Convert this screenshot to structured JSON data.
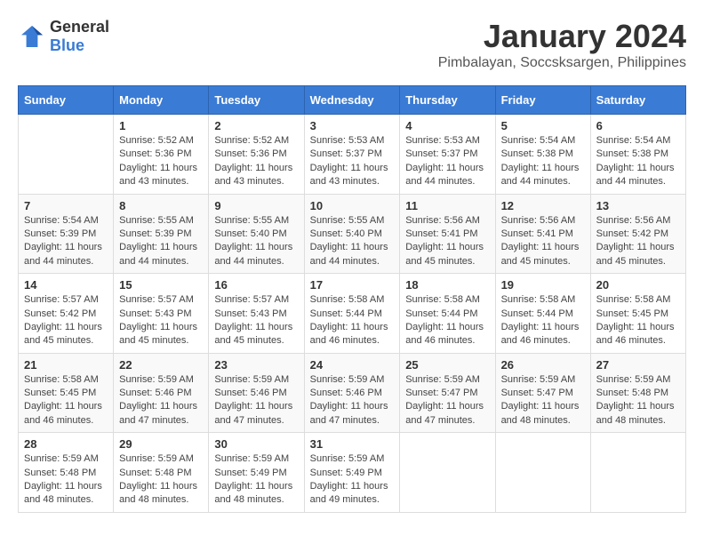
{
  "logo": {
    "general": "General",
    "blue": "Blue"
  },
  "title": "January 2024",
  "location": "Pimbalayan, Soccsksargen, Philippines",
  "days_header": [
    "Sunday",
    "Monday",
    "Tuesday",
    "Wednesday",
    "Thursday",
    "Friday",
    "Saturday"
  ],
  "weeks": [
    [
      {
        "day": "",
        "info": ""
      },
      {
        "day": "1",
        "info": "Sunrise: 5:52 AM\nSunset: 5:36 PM\nDaylight: 11 hours\nand 43 minutes."
      },
      {
        "day": "2",
        "info": "Sunrise: 5:52 AM\nSunset: 5:36 PM\nDaylight: 11 hours\nand 43 minutes."
      },
      {
        "day": "3",
        "info": "Sunrise: 5:53 AM\nSunset: 5:37 PM\nDaylight: 11 hours\nand 43 minutes."
      },
      {
        "day": "4",
        "info": "Sunrise: 5:53 AM\nSunset: 5:37 PM\nDaylight: 11 hours\nand 44 minutes."
      },
      {
        "day": "5",
        "info": "Sunrise: 5:54 AM\nSunset: 5:38 PM\nDaylight: 11 hours\nand 44 minutes."
      },
      {
        "day": "6",
        "info": "Sunrise: 5:54 AM\nSunset: 5:38 PM\nDaylight: 11 hours\nand 44 minutes."
      }
    ],
    [
      {
        "day": "7",
        "info": "Sunrise: 5:54 AM\nSunset: 5:39 PM\nDaylight: 11 hours\nand 44 minutes."
      },
      {
        "day": "8",
        "info": "Sunrise: 5:55 AM\nSunset: 5:39 PM\nDaylight: 11 hours\nand 44 minutes."
      },
      {
        "day": "9",
        "info": "Sunrise: 5:55 AM\nSunset: 5:40 PM\nDaylight: 11 hours\nand 44 minutes."
      },
      {
        "day": "10",
        "info": "Sunrise: 5:55 AM\nSunset: 5:40 PM\nDaylight: 11 hours\nand 44 minutes."
      },
      {
        "day": "11",
        "info": "Sunrise: 5:56 AM\nSunset: 5:41 PM\nDaylight: 11 hours\nand 45 minutes."
      },
      {
        "day": "12",
        "info": "Sunrise: 5:56 AM\nSunset: 5:41 PM\nDaylight: 11 hours\nand 45 minutes."
      },
      {
        "day": "13",
        "info": "Sunrise: 5:56 AM\nSunset: 5:42 PM\nDaylight: 11 hours\nand 45 minutes."
      }
    ],
    [
      {
        "day": "14",
        "info": "Sunrise: 5:57 AM\nSunset: 5:42 PM\nDaylight: 11 hours\nand 45 minutes."
      },
      {
        "day": "15",
        "info": "Sunrise: 5:57 AM\nSunset: 5:43 PM\nDaylight: 11 hours\nand 45 minutes."
      },
      {
        "day": "16",
        "info": "Sunrise: 5:57 AM\nSunset: 5:43 PM\nDaylight: 11 hours\nand 45 minutes."
      },
      {
        "day": "17",
        "info": "Sunrise: 5:58 AM\nSunset: 5:44 PM\nDaylight: 11 hours\nand 46 minutes."
      },
      {
        "day": "18",
        "info": "Sunrise: 5:58 AM\nSunset: 5:44 PM\nDaylight: 11 hours\nand 46 minutes."
      },
      {
        "day": "19",
        "info": "Sunrise: 5:58 AM\nSunset: 5:44 PM\nDaylight: 11 hours\nand 46 minutes."
      },
      {
        "day": "20",
        "info": "Sunrise: 5:58 AM\nSunset: 5:45 PM\nDaylight: 11 hours\nand 46 minutes."
      }
    ],
    [
      {
        "day": "21",
        "info": "Sunrise: 5:58 AM\nSunset: 5:45 PM\nDaylight: 11 hours\nand 46 minutes."
      },
      {
        "day": "22",
        "info": "Sunrise: 5:59 AM\nSunset: 5:46 PM\nDaylight: 11 hours\nand 47 minutes."
      },
      {
        "day": "23",
        "info": "Sunrise: 5:59 AM\nSunset: 5:46 PM\nDaylight: 11 hours\nand 47 minutes."
      },
      {
        "day": "24",
        "info": "Sunrise: 5:59 AM\nSunset: 5:46 PM\nDaylight: 11 hours\nand 47 minutes."
      },
      {
        "day": "25",
        "info": "Sunrise: 5:59 AM\nSunset: 5:47 PM\nDaylight: 11 hours\nand 47 minutes."
      },
      {
        "day": "26",
        "info": "Sunrise: 5:59 AM\nSunset: 5:47 PM\nDaylight: 11 hours\nand 48 minutes."
      },
      {
        "day": "27",
        "info": "Sunrise: 5:59 AM\nSunset: 5:48 PM\nDaylight: 11 hours\nand 48 minutes."
      }
    ],
    [
      {
        "day": "28",
        "info": "Sunrise: 5:59 AM\nSunset: 5:48 PM\nDaylight: 11 hours\nand 48 minutes."
      },
      {
        "day": "29",
        "info": "Sunrise: 5:59 AM\nSunset: 5:48 PM\nDaylight: 11 hours\nand 48 minutes."
      },
      {
        "day": "30",
        "info": "Sunrise: 5:59 AM\nSunset: 5:49 PM\nDaylight: 11 hours\nand 48 minutes."
      },
      {
        "day": "31",
        "info": "Sunrise: 5:59 AM\nSunset: 5:49 PM\nDaylight: 11 hours\nand 49 minutes."
      },
      {
        "day": "",
        "info": ""
      },
      {
        "day": "",
        "info": ""
      },
      {
        "day": "",
        "info": ""
      }
    ]
  ]
}
